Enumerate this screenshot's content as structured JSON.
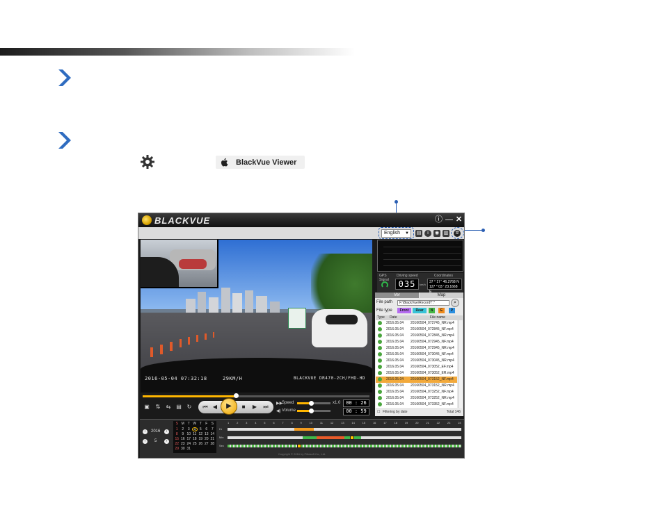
{
  "app": {
    "brand": "BLACKVUE",
    "language_selected": "English",
    "mac_badge_label": "BlackVue Viewer"
  },
  "video": {
    "timestamp": "2016-05-04  07:32:18",
    "speed_overlay": "29KM/H",
    "model_overlay": "BLACKVUE DR470-2CH/FHD-HD",
    "progress": 0.41
  },
  "playback": {
    "speed_label": "Speed",
    "volume_label": "Volume",
    "speed_value": "x1.0",
    "speed_level": 0.42,
    "volume_level": 0.42,
    "time_current": "00 : 26",
    "time_total": "00 : 59"
  },
  "gps": {
    "gps_label": "GPS Signal",
    "speed_label": "Driving speed",
    "coord_label": "Coordinates",
    "speed_value": "035",
    "speed_unit": "km/h",
    "lat": "37 ° 17 ' 46.2768 N",
    "lon": "127 ° 03 ' 23.1668 E"
  },
  "file_panel": {
    "tab_left": "Ver",
    "tab_right": "Map",
    "path_label": "File path",
    "path_value": "F:\\BlackVue\\Record\\*.*",
    "type_label": "File type",
    "chips": [
      "Front",
      "Rear",
      "N",
      "E",
      "P"
    ],
    "col_type": "Type",
    "col_date": "Date",
    "col_name": "File name",
    "files": [
      {
        "date": "2016.05.04",
        "name": "20160504_072745_NR.mp4",
        "selected": false
      },
      {
        "date": "2016.05.04",
        "name": "20160504_072845_NF.mp4",
        "selected": false
      },
      {
        "date": "2016.05.04",
        "name": "20160504_072845_NR.mp4",
        "selected": false
      },
      {
        "date": "2016.05.04",
        "name": "20160504_072945_NF.mp4",
        "selected": false
      },
      {
        "date": "2016.05.04",
        "name": "20160504_072945_NR.mp4",
        "selected": false
      },
      {
        "date": "2016.05.04",
        "name": "20160504_073045_NF.mp4",
        "selected": false
      },
      {
        "date": "2016.05.04",
        "name": "20160504_073045_NR.mp4",
        "selected": false
      },
      {
        "date": "2016.05.04",
        "name": "20160504_073052_EF.mp4",
        "selected": false
      },
      {
        "date": "2016.05.04",
        "name": "20160504_073052_ER.mp4",
        "selected": false
      },
      {
        "date": "2016.05.04",
        "name": "20160504_073152_NF.mp4",
        "selected": true
      },
      {
        "date": "2016.05.04",
        "name": "20160504_073152_NR.mp4",
        "selected": false
      },
      {
        "date": "2016.05.04",
        "name": "20160504_073252_NF.mp4",
        "selected": false
      },
      {
        "date": "2016.05.04",
        "name": "20160504_073252_NR.mp4",
        "selected": false
      },
      {
        "date": "2016.05.04",
        "name": "20160504_073352_NF.mp4",
        "selected": false
      }
    ],
    "filter_label": "Filtering by date",
    "total": "Total 146"
  },
  "calendar": {
    "year": "2016",
    "month": "5",
    "weekdays": [
      "S",
      "M",
      "T",
      "W",
      "T",
      "F",
      "S"
    ],
    "weeks": [
      [
        "1",
        "2",
        "3",
        "4",
        "5",
        "6",
        "7"
      ],
      [
        "8",
        "9",
        "10",
        "11",
        "12",
        "13",
        "14"
      ],
      [
        "15",
        "16",
        "17",
        "18",
        "19",
        "20",
        "21"
      ],
      [
        "22",
        "23",
        "24",
        "25",
        "26",
        "27",
        "28"
      ],
      [
        "29",
        "30",
        "31",
        "",
        "",
        "",
        ""
      ]
    ]
  },
  "timeline": {
    "hours": [
      "1",
      "2",
      "3",
      "4",
      "5",
      "6",
      "7",
      "8",
      "9",
      "10",
      "11",
      "12",
      "13",
      "14",
      "15",
      "16",
      "17",
      "18",
      "19",
      "20",
      "21",
      "22",
      "23",
      "24"
    ],
    "row_labels": [
      "Hr",
      "Min",
      "Sec"
    ],
    "min_ticks": [
      "10",
      "20",
      "30",
      "40",
      "50",
      "60"
    ],
    "sec_ticks": [
      "10",
      "20",
      "30",
      "40",
      "50",
      "60"
    ]
  },
  "copyright": "Copyright © 2016 by Pittasoft Co., Ltd."
}
